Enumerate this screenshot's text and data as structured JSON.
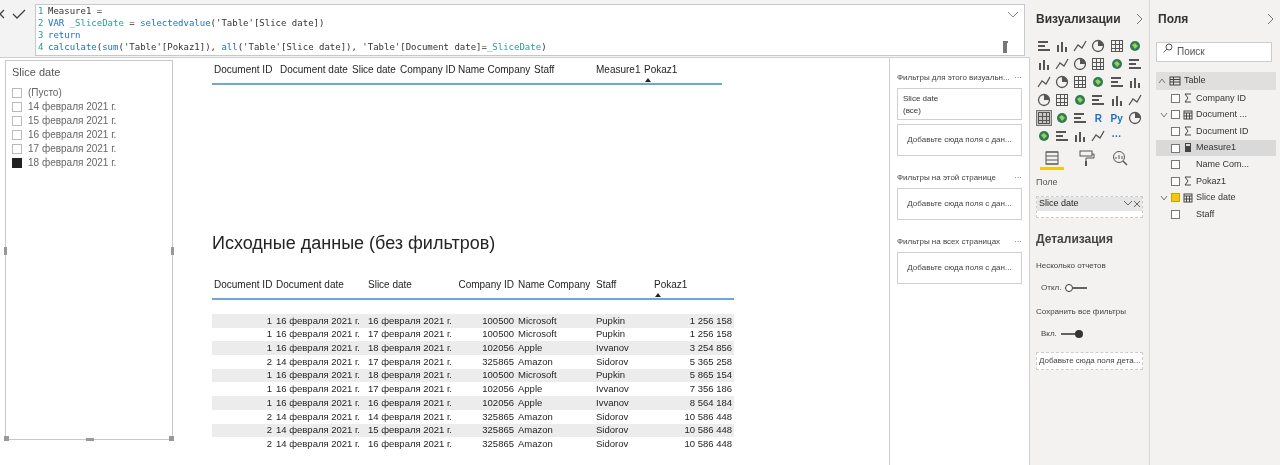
{
  "formula_bar": {
    "lines": [
      {
        "number": "1",
        "tokens": [
          {
            "kind": "plain",
            "text": "Measure1 ="
          }
        ]
      },
      {
        "number": "2",
        "tokens": [
          {
            "kind": "keyword",
            "text": "VAR "
          },
          {
            "kind": "var",
            "text": "_SliceDate"
          },
          {
            "kind": "plain",
            "text": " = "
          },
          {
            "kind": "keyword",
            "text": "selectedvalue"
          },
          {
            "kind": "plain",
            "text": "('Table'[Slice date])"
          }
        ]
      },
      {
        "number": "3",
        "tokens": [
          {
            "kind": "keyword",
            "text": "return"
          }
        ]
      },
      {
        "number": "4",
        "tokens": [
          {
            "kind": "keyword",
            "text": "calculate"
          },
          {
            "kind": "plain",
            "text": "("
          },
          {
            "kind": "keyword",
            "text": "sum"
          },
          {
            "kind": "plain",
            "text": "('Table'[Pokaz1]), "
          },
          {
            "kind": "keyword",
            "text": "all"
          },
          {
            "kind": "plain",
            "text": "('Table'[Slice date]), 'Table'[Document date]="
          },
          {
            "kind": "var",
            "text": "_SliceDate"
          },
          {
            "kind": "plain",
            "text": ")"
          }
        ]
      }
    ]
  },
  "slicer": {
    "title": "Slice date",
    "items": [
      {
        "label": "(Пусто)",
        "checked": false
      },
      {
        "label": "14 февраля 2021 г.",
        "checked": false
      },
      {
        "label": "15 февраля 2021 г.",
        "checked": false
      },
      {
        "label": "16 февраля 2021 г.",
        "checked": false
      },
      {
        "label": "17 февраля 2021 г.",
        "checked": false
      },
      {
        "label": "18 февраля 2021 г.",
        "checked": true
      }
    ]
  },
  "top_table": {
    "columns": [
      {
        "label": "Document ID",
        "sorted": false
      },
      {
        "label": "Document date",
        "sorted": false
      },
      {
        "label": "Slice date",
        "sorted": false
      },
      {
        "label": "Company ID",
        "sorted": false
      },
      {
        "label": "Name Company",
        "sorted": false
      },
      {
        "label": "Staff",
        "sorted": false
      },
      {
        "label": "Measure1",
        "sorted": false
      },
      {
        "label": "Pokaz1",
        "sorted": true
      }
    ]
  },
  "heading": "Исходные данные (без фильтров)",
  "table": {
    "columns": [
      {
        "label": "Document ID",
        "sorted": false
      },
      {
        "label": "Document date",
        "sorted": false
      },
      {
        "label": "Slice date",
        "sorted": false
      },
      {
        "label": "Company ID",
        "sorted": false
      },
      {
        "label": "Name Company",
        "sorted": false
      },
      {
        "label": "Staff",
        "sorted": false
      },
      {
        "label": "Pokaz1",
        "sorted": true
      }
    ],
    "rows": [
      [
        "1",
        "16 февраля 2021 г.",
        "16 февраля 2021 г.",
        "100500",
        "Microsoft",
        "Pupkin",
        "1 256 158"
      ],
      [
        "1",
        "16 февраля 2021 г.",
        "17 февраля 2021 г.",
        "100500",
        "Microsoft",
        "Pupkin",
        "1 256 158"
      ],
      [
        "1",
        "16 февраля 2021 г.",
        "18 февраля 2021 г.",
        "102056",
        "Apple",
        "Ivvanov",
        "3 254 856"
      ],
      [
        "2",
        "14 февраля 2021 г.",
        "17 февраля 2021 г.",
        "325865",
        "Amazon",
        "Sidorov",
        "5 365 258"
      ],
      [
        "1",
        "16 февраля 2021 г.",
        "18 февраля 2021 г.",
        "100500",
        "Microsoft",
        "Pupkin",
        "5 865 154"
      ],
      [
        "1",
        "16 февраля 2021 г.",
        "17 февраля 2021 г.",
        "102056",
        "Apple",
        "Ivvanov",
        "7 356 186"
      ],
      [
        "1",
        "16 февраля 2021 г.",
        "16 февраля 2021 г.",
        "102056",
        "Apple",
        "Ivvanov",
        "8 564 184"
      ],
      [
        "2",
        "14 февраля 2021 г.",
        "14 февраля 2021 г.",
        "325865",
        "Amazon",
        "Sidorov",
        "10 586 448"
      ],
      [
        "2",
        "14 февраля 2021 г.",
        "15 февраля 2021 г.",
        "325865",
        "Amazon",
        "Sidorov",
        "10 586 448"
      ],
      [
        "2",
        "14 февраля 2021 г.",
        "16 февраля 2021 г.",
        "325865",
        "Amazon",
        "Sidorov",
        "10 586 448"
      ]
    ]
  },
  "filters": {
    "sections": [
      {
        "title": "Фильтры для этого визуальн...",
        "more": "···",
        "cards": [
          {
            "kind": "filter",
            "name": "Slice date",
            "value": "(все)"
          },
          {
            "kind": "drop",
            "text": "Добавьте сюда поля с дан..."
          }
        ]
      },
      {
        "title": "Фильтры на этой странице",
        "more": "···",
        "cards": [
          {
            "kind": "drop",
            "text": "Добавьте сюда поля с дан..."
          }
        ]
      },
      {
        "title": "Фильтры на всех страницах",
        "more": "···",
        "cards": [
          {
            "kind": "drop",
            "text": "Добавьте сюда поля с дан..."
          }
        ]
      }
    ]
  },
  "visualizations": {
    "title": "Визуализации",
    "gallery": [
      {
        "selected": false
      },
      {
        "selected": false
      },
      {
        "selected": false
      },
      {
        "selected": false
      },
      {
        "selected": false
      },
      {
        "selected": false
      },
      {
        "selected": false
      },
      {
        "selected": false
      },
      {
        "selected": false
      },
      {
        "selected": false
      },
      {
        "selected": false
      },
      {
        "selected": false
      },
      {
        "selected": false
      },
      {
        "selected": false
      },
      {
        "selected": false
      },
      {
        "selected": false
      },
      {
        "selected": false
      },
      {
        "selected": false
      },
      {
        "selected": false
      },
      {
        "selected": false
      },
      {
        "selected": false
      },
      {
        "selected": false
      },
      {
        "selected": false
      },
      {
        "selected": false
      },
      {
        "selected": true
      },
      {
        "selected": false
      },
      {
        "selected": false
      },
      {
        "selected": false,
        "label": "R"
      },
      {
        "selected": false,
        "label": "Py"
      },
      {
        "selected": false
      },
      {
        "selected": false
      },
      {
        "selected": false
      },
      {
        "selected": false
      },
      {
        "selected": false
      },
      {
        "selected": false,
        "label": "···"
      }
    ],
    "tabs": [
      {
        "kind": "fields",
        "selected": true
      },
      {
        "kind": "format",
        "selected": false
      },
      {
        "kind": "analytics",
        "selected": false
      }
    ],
    "field_label": "Поле",
    "field_value": "Slice date",
    "drillthrough": {
      "title": "Детализация",
      "options": [
        {
          "label": "Несколько отчетов",
          "toggle": "Откл.",
          "on": false
        },
        {
          "label": "Сохранить все фильтры",
          "toggle": "Вкл.",
          "on": true
        }
      ],
      "drop": "Добавьте сюда поля дета..."
    }
  },
  "fields": {
    "title": "Поля",
    "search": {
      "placeholder": "Поиск"
    },
    "tree": [
      {
        "label": "Table",
        "kind": "table",
        "expanded": true,
        "children": [
          {
            "label": "Company ID",
            "kind": "sigma",
            "checked": false,
            "expandable": false,
            "selected": false
          },
          {
            "label": "Document ...",
            "kind": "calendar",
            "checked": false,
            "expandable": true,
            "selected": false
          },
          {
            "label": "Document ID",
            "kind": "sigma",
            "checked": false,
            "expandable": false,
            "selected": false
          },
          {
            "label": "Measure1",
            "kind": "calculator",
            "checked": false,
            "expandable": false,
            "selected": true
          },
          {
            "label": "Name Com...",
            "kind": "none",
            "checked": false,
            "expandable": false,
            "selected": false
          },
          {
            "label": "Pokaz1",
            "kind": "sigma",
            "checked": false,
            "expandable": false,
            "selected": false
          },
          {
            "label": "Slice date",
            "kind": "calendar",
            "checked": true,
            "expandable": true,
            "selected": false
          },
          {
            "label": "Staff",
            "kind": "none",
            "checked": false,
            "expandable": false,
            "selected": false
          }
        ]
      }
    ]
  }
}
